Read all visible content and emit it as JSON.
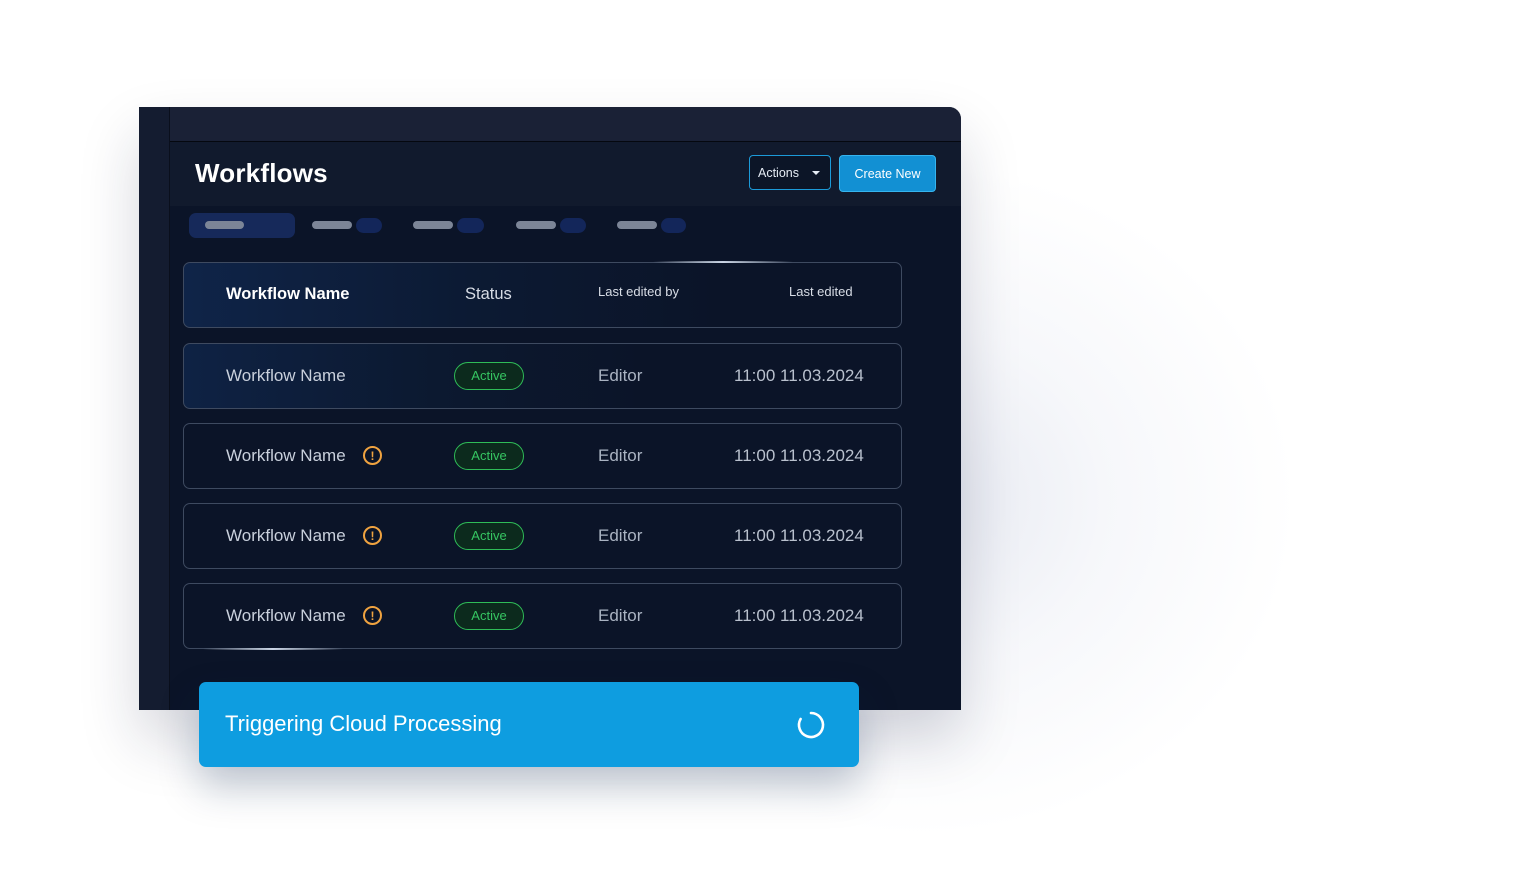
{
  "header": {
    "title": "Workflows",
    "actions_label": "Actions",
    "create_label": "Create New"
  },
  "table": {
    "columns": [
      "Workflow Name",
      "Status",
      "Last edited by",
      "Last edited"
    ],
    "rows": [
      {
        "name": "Workflow Name",
        "warning": false,
        "status": "Active",
        "editor": "Editor",
        "edited": "11:00 11.03.2024"
      },
      {
        "name": "Workflow Name",
        "warning": true,
        "status": "Active",
        "editor": "Editor",
        "edited": "11:00 11.03.2024"
      },
      {
        "name": "Workflow Name",
        "warning": true,
        "status": "Active",
        "editor": "Editor",
        "edited": "11:00 11.03.2024"
      },
      {
        "name": "Workflow Name",
        "warning": true,
        "status": "Active",
        "editor": "Editor",
        "edited": "11:00 11.03.2024"
      }
    ]
  },
  "toast": {
    "message": "Triggering Cloud Processing"
  },
  "icons": {
    "actions_caret": "chevron-down-icon",
    "warning": "warning-circle-icon",
    "spinner": "spinner-icon"
  },
  "colors": {
    "accent": "#1290d3",
    "toast": "#0e9de0",
    "status_active": "#36c562",
    "warning": "#f0a340",
    "window_bg": "#0b1428"
  }
}
